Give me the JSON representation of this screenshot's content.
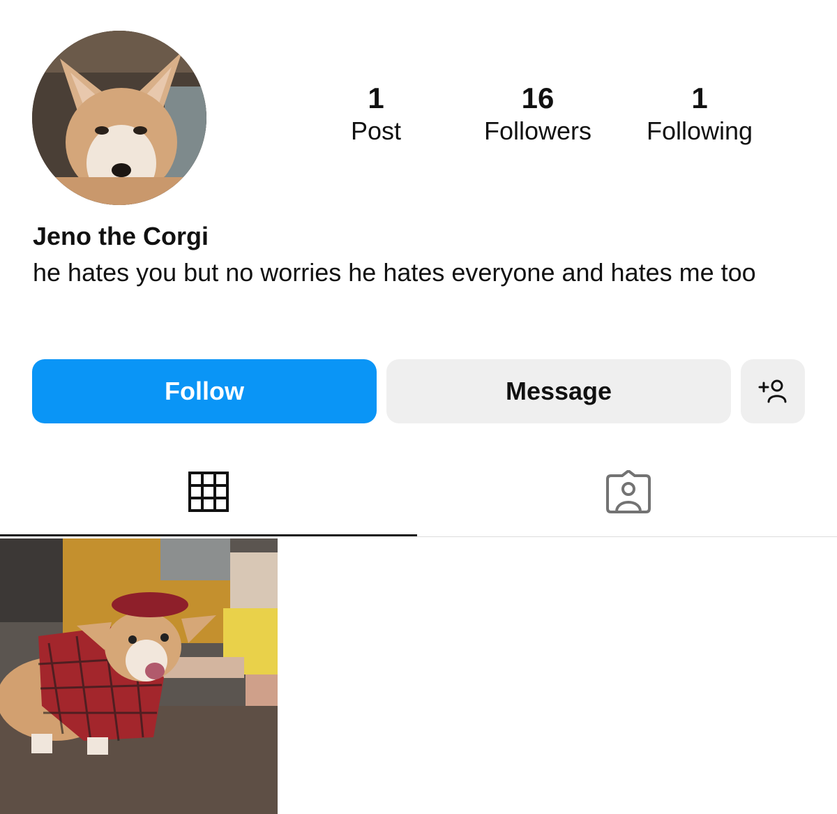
{
  "profile": {
    "name": "Jeno the Corgi",
    "bio": "he hates you but no worries he hates everyone and hates me too",
    "avatar_alt": "corgi-avatar"
  },
  "stats": [
    {
      "value": "1",
      "label": "Post"
    },
    {
      "value": "16",
      "label": "Followers"
    },
    {
      "value": "1",
      "label": "Following"
    }
  ],
  "actions": {
    "follow_label": "Follow",
    "message_label": "Message",
    "add_icon": "add-user-icon"
  },
  "tabs": [
    {
      "icon": "grid-icon",
      "active": true
    },
    {
      "icon": "tagged-person-icon",
      "active": false
    }
  ],
  "colors": {
    "follow_blue": "#0a95f6",
    "secondary_button": "#efefef",
    "text": "#111111"
  },
  "posts": [
    {
      "description": "corgi-in-plaid-outfit"
    }
  ]
}
